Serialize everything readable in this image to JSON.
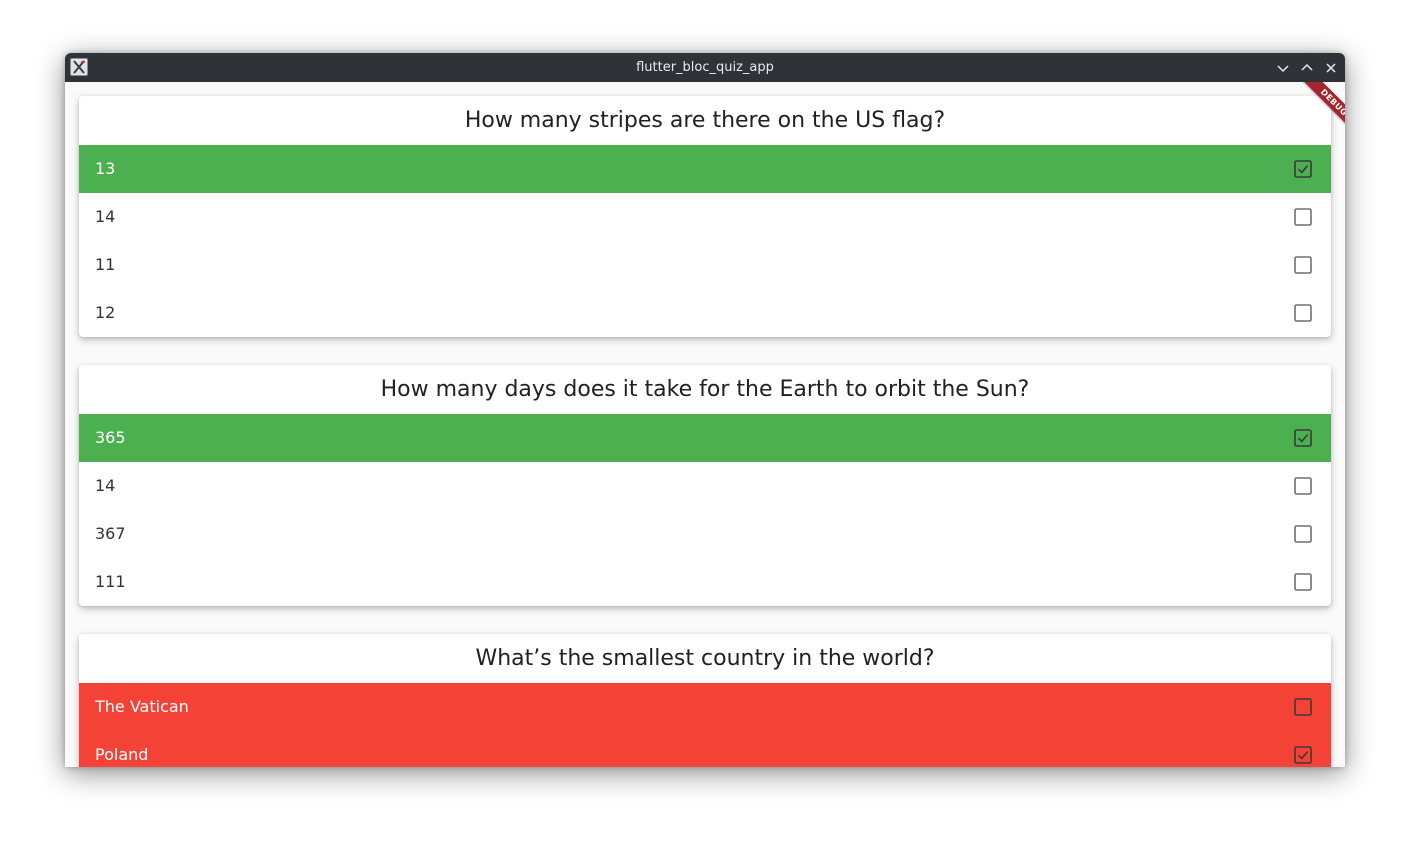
{
  "window": {
    "title": "flutter_bloc_quiz_app",
    "controls": [
      "minimize-icon",
      "maximize-icon",
      "close-icon"
    ]
  },
  "debug_banner": "DEBUG",
  "colors": {
    "correct": "#4caf50",
    "wrong": "#f44336",
    "titlebar": "#2f3338"
  },
  "questions": [
    {
      "text": "How many stripes are there on the US flag?",
      "answers": [
        {
          "label": "13",
          "state": "correct",
          "checked": true
        },
        {
          "label": "14",
          "state": "none",
          "checked": false
        },
        {
          "label": "11",
          "state": "none",
          "checked": false
        },
        {
          "label": "12",
          "state": "none",
          "checked": false
        }
      ]
    },
    {
      "text": "How many days does it take for the Earth to orbit the Sun?",
      "answers": [
        {
          "label": "365",
          "state": "correct",
          "checked": true
        },
        {
          "label": "14",
          "state": "none",
          "checked": false
        },
        {
          "label": "367",
          "state": "none",
          "checked": false
        },
        {
          "label": "111",
          "state": "none",
          "checked": false
        }
      ]
    },
    {
      "text": "What’s the smallest country in the world?",
      "answers": [
        {
          "label": "The Vatican",
          "state": "wrong",
          "checked": false
        },
        {
          "label": "Poland",
          "state": "wrong",
          "checked": true
        }
      ]
    }
  ]
}
